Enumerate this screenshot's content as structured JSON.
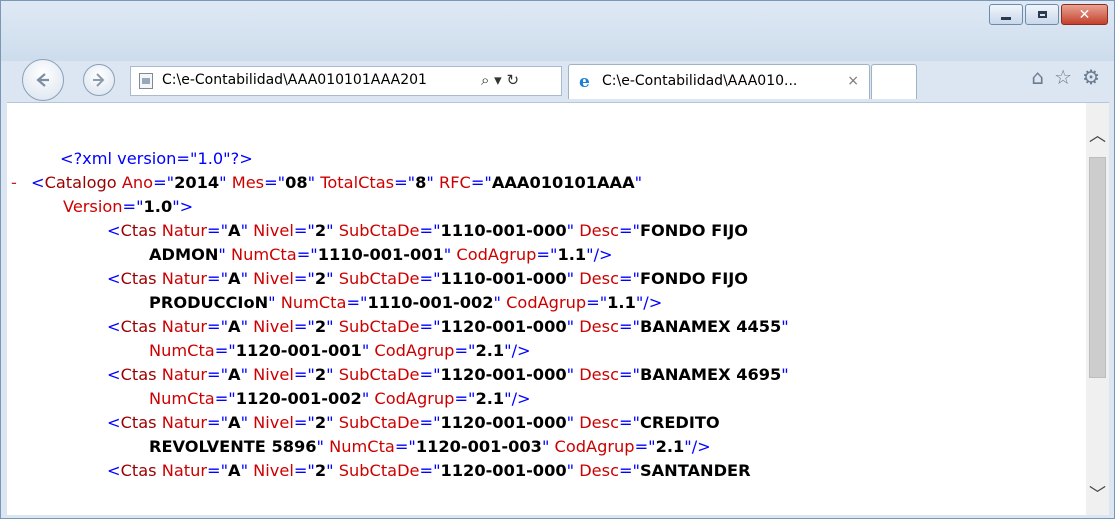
{
  "browser": {
    "address_text": "C:\\e-Contabilidad\\AAA010101AAA201",
    "address_tools": "⌕ ▾ ↻",
    "tab_label": "C:\\e-Contabilidad\\AAA010...",
    "tab_close": "×",
    "icons": [
      "home-icon",
      "favorites-star-icon",
      "settings-gear-icon"
    ]
  },
  "xml": {
    "declaration": "<?xml version=\"1.0\"?>",
    "collapse_marker": "-",
    "root": {
      "tag": "Catalogo",
      "attrs": [
        {
          "name": "Ano",
          "value": "2014"
        },
        {
          "name": "Mes",
          "value": "08"
        },
        {
          "name": "TotalCtas",
          "value": "8"
        },
        {
          "name": "RFC",
          "value": "AAA010101AAA"
        },
        {
          "name": "Version",
          "value": "1.0"
        }
      ]
    },
    "lines": [
      {
        "indent": 2,
        "parts": [
          [
            "m",
            "<"
          ],
          [
            "t",
            "Ctas"
          ],
          [
            "a",
            " Natur"
          ],
          [
            "m",
            "=\""
          ],
          [
            "v",
            "A"
          ],
          [
            "m",
            "\""
          ],
          [
            "a",
            " Nivel"
          ],
          [
            "m",
            "=\""
          ],
          [
            "v",
            "2"
          ],
          [
            "m",
            "\""
          ],
          [
            "a",
            " SubCtaDe"
          ],
          [
            "m",
            "=\""
          ],
          [
            "v",
            "1110-001-000"
          ],
          [
            "m",
            "\""
          ],
          [
            "a",
            " Desc"
          ],
          [
            "m",
            "=\""
          ],
          [
            "v",
            "FONDO FIJO"
          ]
        ]
      },
      {
        "indent": 3,
        "parts": [
          [
            "v",
            "ADMON"
          ],
          [
            "m",
            "\""
          ],
          [
            "a",
            " NumCta"
          ],
          [
            "m",
            "=\""
          ],
          [
            "v",
            "1110-001-001"
          ],
          [
            "m",
            "\""
          ],
          [
            "a",
            " CodAgrup"
          ],
          [
            "m",
            "=\""
          ],
          [
            "v",
            "1.1"
          ],
          [
            "m",
            "\"/>"
          ]
        ]
      },
      {
        "indent": 2,
        "parts": [
          [
            "m",
            "<"
          ],
          [
            "t",
            "Ctas"
          ],
          [
            "a",
            " Natur"
          ],
          [
            "m",
            "=\""
          ],
          [
            "v",
            "A"
          ],
          [
            "m",
            "\""
          ],
          [
            "a",
            " Nivel"
          ],
          [
            "m",
            "=\""
          ],
          [
            "v",
            "2"
          ],
          [
            "m",
            "\""
          ],
          [
            "a",
            " SubCtaDe"
          ],
          [
            "m",
            "=\""
          ],
          [
            "v",
            "1110-001-000"
          ],
          [
            "m",
            "\""
          ],
          [
            "a",
            " Desc"
          ],
          [
            "m",
            "=\""
          ],
          [
            "v",
            "FONDO FIJO"
          ]
        ]
      },
      {
        "indent": 3,
        "parts": [
          [
            "v",
            "PRODUCCIoN"
          ],
          [
            "m",
            "\""
          ],
          [
            "a",
            " NumCta"
          ],
          [
            "m",
            "=\""
          ],
          [
            "v",
            "1110-001-002"
          ],
          [
            "m",
            "\""
          ],
          [
            "a",
            " CodAgrup"
          ],
          [
            "m",
            "=\""
          ],
          [
            "v",
            "1.1"
          ],
          [
            "m",
            "\"/>"
          ]
        ]
      },
      {
        "indent": 2,
        "parts": [
          [
            "m",
            "<"
          ],
          [
            "t",
            "Ctas"
          ],
          [
            "a",
            " Natur"
          ],
          [
            "m",
            "=\""
          ],
          [
            "v",
            "A"
          ],
          [
            "m",
            "\""
          ],
          [
            "a",
            " Nivel"
          ],
          [
            "m",
            "=\""
          ],
          [
            "v",
            "2"
          ],
          [
            "m",
            "\""
          ],
          [
            "a",
            " SubCtaDe"
          ],
          [
            "m",
            "=\""
          ],
          [
            "v",
            "1120-001-000"
          ],
          [
            "m",
            "\""
          ],
          [
            "a",
            " Desc"
          ],
          [
            "m",
            "=\""
          ],
          [
            "v",
            "BANAMEX 4455"
          ],
          [
            "m",
            "\""
          ]
        ]
      },
      {
        "indent": 3,
        "parts": [
          [
            "a",
            "NumCta"
          ],
          [
            "m",
            "=\""
          ],
          [
            "v",
            "1120-001-001"
          ],
          [
            "m",
            "\""
          ],
          [
            "a",
            " CodAgrup"
          ],
          [
            "m",
            "=\""
          ],
          [
            "v",
            "2.1"
          ],
          [
            "m",
            "\"/>"
          ]
        ]
      },
      {
        "indent": 2,
        "parts": [
          [
            "m",
            "<"
          ],
          [
            "t",
            "Ctas"
          ],
          [
            "a",
            " Natur"
          ],
          [
            "m",
            "=\""
          ],
          [
            "v",
            "A"
          ],
          [
            "m",
            "\""
          ],
          [
            "a",
            " Nivel"
          ],
          [
            "m",
            "=\""
          ],
          [
            "v",
            "2"
          ],
          [
            "m",
            "\""
          ],
          [
            "a",
            " SubCtaDe"
          ],
          [
            "m",
            "=\""
          ],
          [
            "v",
            "1120-001-000"
          ],
          [
            "m",
            "\""
          ],
          [
            "a",
            " Desc"
          ],
          [
            "m",
            "=\""
          ],
          [
            "v",
            "BANAMEX 4695"
          ],
          [
            "m",
            "\""
          ]
        ]
      },
      {
        "indent": 3,
        "parts": [
          [
            "a",
            "NumCta"
          ],
          [
            "m",
            "=\""
          ],
          [
            "v",
            "1120-001-002"
          ],
          [
            "m",
            "\""
          ],
          [
            "a",
            " CodAgrup"
          ],
          [
            "m",
            "=\""
          ],
          [
            "v",
            "2.1"
          ],
          [
            "m",
            "\"/>"
          ]
        ]
      },
      {
        "indent": 2,
        "parts": [
          [
            "m",
            "<"
          ],
          [
            "t",
            "Ctas"
          ],
          [
            "a",
            " Natur"
          ],
          [
            "m",
            "=\""
          ],
          [
            "v",
            "A"
          ],
          [
            "m",
            "\""
          ],
          [
            "a",
            " Nivel"
          ],
          [
            "m",
            "=\""
          ],
          [
            "v",
            "2"
          ],
          [
            "m",
            "\""
          ],
          [
            "a",
            " SubCtaDe"
          ],
          [
            "m",
            "=\""
          ],
          [
            "v",
            "1120-001-000"
          ],
          [
            "m",
            "\""
          ],
          [
            "a",
            " Desc"
          ],
          [
            "m",
            "=\""
          ],
          [
            "v",
            "CREDITO"
          ]
        ]
      },
      {
        "indent": 3,
        "parts": [
          [
            "v",
            "REVOLVENTE 5896"
          ],
          [
            "m",
            "\""
          ],
          [
            "a",
            " NumCta"
          ],
          [
            "m",
            "=\""
          ],
          [
            "v",
            "1120-001-003"
          ],
          [
            "m",
            "\""
          ],
          [
            "a",
            " CodAgrup"
          ],
          [
            "m",
            "=\""
          ],
          [
            "v",
            "2.1"
          ],
          [
            "m",
            "\"/>"
          ]
        ]
      },
      {
        "indent": 2,
        "parts": [
          [
            "m",
            "<"
          ],
          [
            "t",
            "Ctas"
          ],
          [
            "a",
            " Natur"
          ],
          [
            "m",
            "=\""
          ],
          [
            "v",
            "A"
          ],
          [
            "m",
            "\""
          ],
          [
            "a",
            " Nivel"
          ],
          [
            "m",
            "=\""
          ],
          [
            "v",
            "2"
          ],
          [
            "m",
            "\""
          ],
          [
            "a",
            " SubCtaDe"
          ],
          [
            "m",
            "=\""
          ],
          [
            "v",
            "1120-001-000"
          ],
          [
            "m",
            "\""
          ],
          [
            "a",
            " Desc"
          ],
          [
            "m",
            "=\""
          ],
          [
            "v",
            "SANTANDER"
          ]
        ]
      }
    ]
  },
  "colors": {
    "markup": "#0000ff",
    "tag_name": "#990000",
    "attr_name": "#cc0000",
    "attr_value": "#000000"
  }
}
